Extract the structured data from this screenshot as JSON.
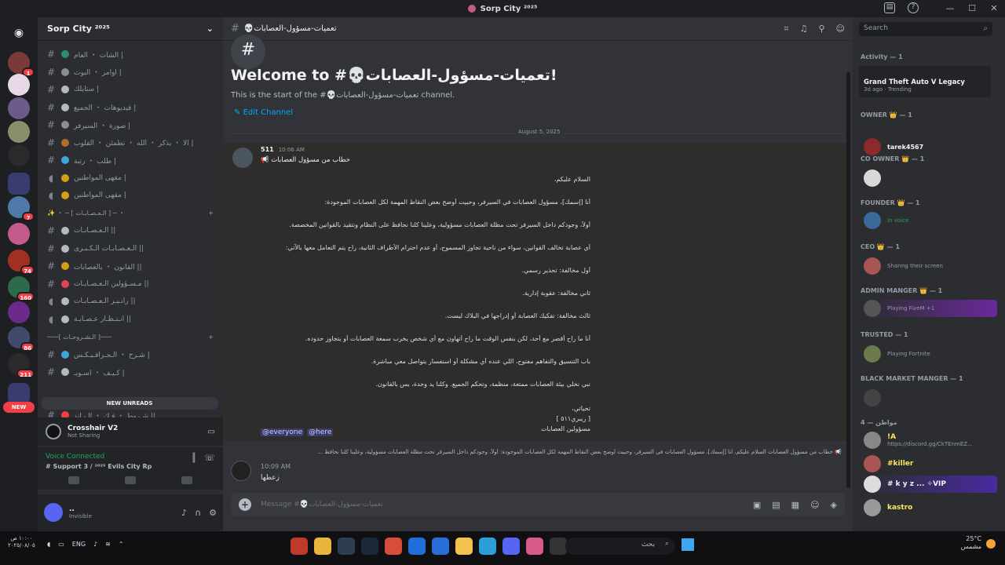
{
  "window": {
    "title": "Sorp City ²⁰²⁵"
  },
  "server": {
    "name": "Sorp City ²⁰²⁵"
  },
  "channels": [
    {
      "name": "الشات ・ العام |",
      "emoji_color": "#2d8f6f"
    },
    {
      "name": "اوامر ・ البوت |",
      "emoji_color": "#8a8d93"
    },
    {
      "name": "ستايلك |",
      "emoji_color": "#b5bac1"
    },
    {
      "name": "فيديوهات ・ الجميع |",
      "emoji_color": "#b5bac1"
    },
    {
      "name": "صورة ・ السيرفر |",
      "emoji_color": "#8a8d93"
    },
    {
      "name": "الا ・ بذكر ・ الله ・ تطمئن ・ القلوب |",
      "emoji_color": "#b56a2a"
    },
    {
      "name": "طلب ・ رتبة |",
      "emoji_color": "#3fa7d6"
    },
    {
      "name": "مقهى المواطنين |",
      "emoji_color": "#d4a017"
    },
    {
      "name": "مقهى المواطنين |",
      "emoji_color": "#d4a017"
    }
  ],
  "category1": {
    "label": "✨ ・ ─ [ الـعـصـابـات ] ─ ・"
  },
  "channels2": [
    {
      "name": "الـعـصـابـات ||",
      "emoji_color": "#b5bac1"
    },
    {
      "name": "الـعـصـابـات الـكـبـرى ||",
      "emoji_color": "#b5bac1"
    },
    {
      "name": "القانون ・ بالعصابات ||",
      "emoji_color": "#d4a017"
    },
    {
      "name": "مـسـؤولين الـعـصـابـات ||",
      "emoji_color": "#e0425a"
    },
    {
      "name": "رانـيـر الـعـصـابـات ||",
      "emoji_color": "#b5bac1"
    },
    {
      "name": "انـتـظـار عـصـابـة ||",
      "emoji_color": "#b5bac1"
    }
  ],
  "category2": {
    "label": "───[ الـشـروحـات ]───"
  },
  "channels3": [
    {
      "name": "شـرح ・ الـجـرافـيـكـس |",
      "emoji_color": "#3fa7d6"
    },
    {
      "name": "كـيـف ・ اسـويـ |",
      "emoji_color": "#b5bac1"
    },
    {
      "name": "شـروط ・ فـك ・ الـبـاند ||",
      "emoji_color": "#f23f43"
    }
  ],
  "new_unreads": "NEW UNREADS",
  "rail": {
    "new_label": "NEW",
    "badges": [
      "1",
      "8",
      "7",
      "74",
      "160",
      "86",
      "211"
    ]
  },
  "activity_card": {
    "title": "Crosshair V2",
    "status": "Not Sharing"
  },
  "voice": {
    "status": "Voice Connected",
    "channel": "# Support 3 / ²⁰²⁵ Evils City Rp"
  },
  "user": {
    "name": "..",
    "status": "Invisible"
  },
  "main": {
    "channel_name": "💀تعميات-مسؤول-العصابات",
    "welcome_title": "Welcome to #💀تعميات-مسؤول-العصابات!",
    "welcome_sub": "This is the start of the #💀تعميات-مسؤول-العصابات channel.",
    "edit_channel": "Edit Channel",
    "date": "August 5, 2025",
    "msg": {
      "author": "511",
      "time": "10:06 AM",
      "title": "📢 خطاب من مسؤول العصابات",
      "lines": [
        "السلام عليكم،",
        "أنا [إسمك]، مسؤول العصابات في السيرفر، وحبيت أوضح بعض النقاط المهمة لكل العصابات الموجودة:",
        "أولاً، وجودكم داخل السيرفر تحت مظلة العصابات مسؤولية، وعلينا كلنا نحافظ على النظام ونتقيد بالقوانين المخصصة.",
        "أي عصابة تخالف القوانين، سواء من ناحية تجاوز المسموح، أو عدم احترام الأطراف الثانية، راح يتم التعامل معها بالآتي:",
        "أول مخالفة: تحذير رسمي.",
        "ثاني مخالفة: عقوبة إدارية.",
        "ثالث مخالفة: تفكيك العصابة أو إدراجها في البلاك ليست.",
        "أنا ما راح أقصر مع أحد، لكن بنفس الوقت ما راح أتهاون مع أي شخص يخرب سمعة العصابات أو يتجاوز حدوده.",
        "باب التنسيق والتفاهم مفتوح، اللي عنده أي مشكلة أو استفسار يتواصل معي مباشرة.",
        "نبي نخلي بيئة العصابات ممتعة، منظمة، وتحكم الجميع. وكلنا يد وحدة، بس بالقانون.",
        "تحياتي،\n[ ريبري٥١١ ]\nمسؤولين العصابات"
      ],
      "mention_everyone": "@everyone",
      "mention_here": "@here"
    },
    "reply": {
      "preview": "📢 خطاب من مسؤول العصابات  السلام عليكم، أنا [إسمك]، مسؤول العصابات في السيرفر، وحبيت أوضح بعض النقاط المهمة لكل العصابات الموجودة:  أولاً، وجودكم داخل السيرفر تحت مظلة العصابات مسؤولية، وعلينا كلنا نحافظ ...",
      "time": "10:09 AM",
      "body": "زعطها"
    },
    "composer_placeholder": "Message #💀تعميات-مسؤول-العصابات"
  },
  "members": {
    "search_placeholder": "Search",
    "activity_header": "Activity — 1",
    "gta_title": "Grand Theft Auto V Legacy",
    "gta_meta": "3d ago · Trending",
    "sections": [
      {
        "title": "OWNER 👑 — 1",
        "name": "tarek4567",
        "sub": "",
        "color": "#f2f3f5"
      },
      {
        "title": "CO OWNER 👑 — 1",
        "name": "",
        "sub": "",
        "color": "#f2f3f5"
      },
      {
        "title": "FOUNDER 👑 — 1",
        "name": "",
        "sub": "In voice",
        "color": "#f2f3f5"
      },
      {
        "title": "CEO 👑 — 1",
        "name": "",
        "sub": "Sharing their screen",
        "color": "#f2f3f5"
      },
      {
        "title": "ADMIN MANGER 👑 — 1",
        "name": "",
        "sub": "Playing FiveM +1",
        "color": "#f2f3f5"
      },
      {
        "title": "TRUSTED — 1",
        "name": "",
        "sub": "Playing Fortnite",
        "color": "#f2f3f5"
      },
      {
        "title": "BLACK MARKET MANGER — 1",
        "name": "",
        "sub": "",
        "color": "#f2f3f5"
      }
    ],
    "citizens_header": "مواطن — 4",
    "citizens": [
      {
        "name": "!A",
        "sub": "https://discord.gg/CkTEnmEZ...",
        "color": "#fee75c"
      },
      {
        "name": "#killer",
        "sub": "",
        "color": "#fee75c"
      },
      {
        "name": "# k y z ...  ✧VIP",
        "sub": "",
        "color": "#fee75c"
      },
      {
        "name": "kastro",
        "sub": "",
        "color": "#fee75c"
      }
    ]
  },
  "taskbar": {
    "time": "١٠:٠٠ ص",
    "date": "٢٠٢٥/٠٨/٠٥",
    "lang": "ENG",
    "search": "بحث",
    "weather": "25°C",
    "weather_desc": "مشمس"
  }
}
